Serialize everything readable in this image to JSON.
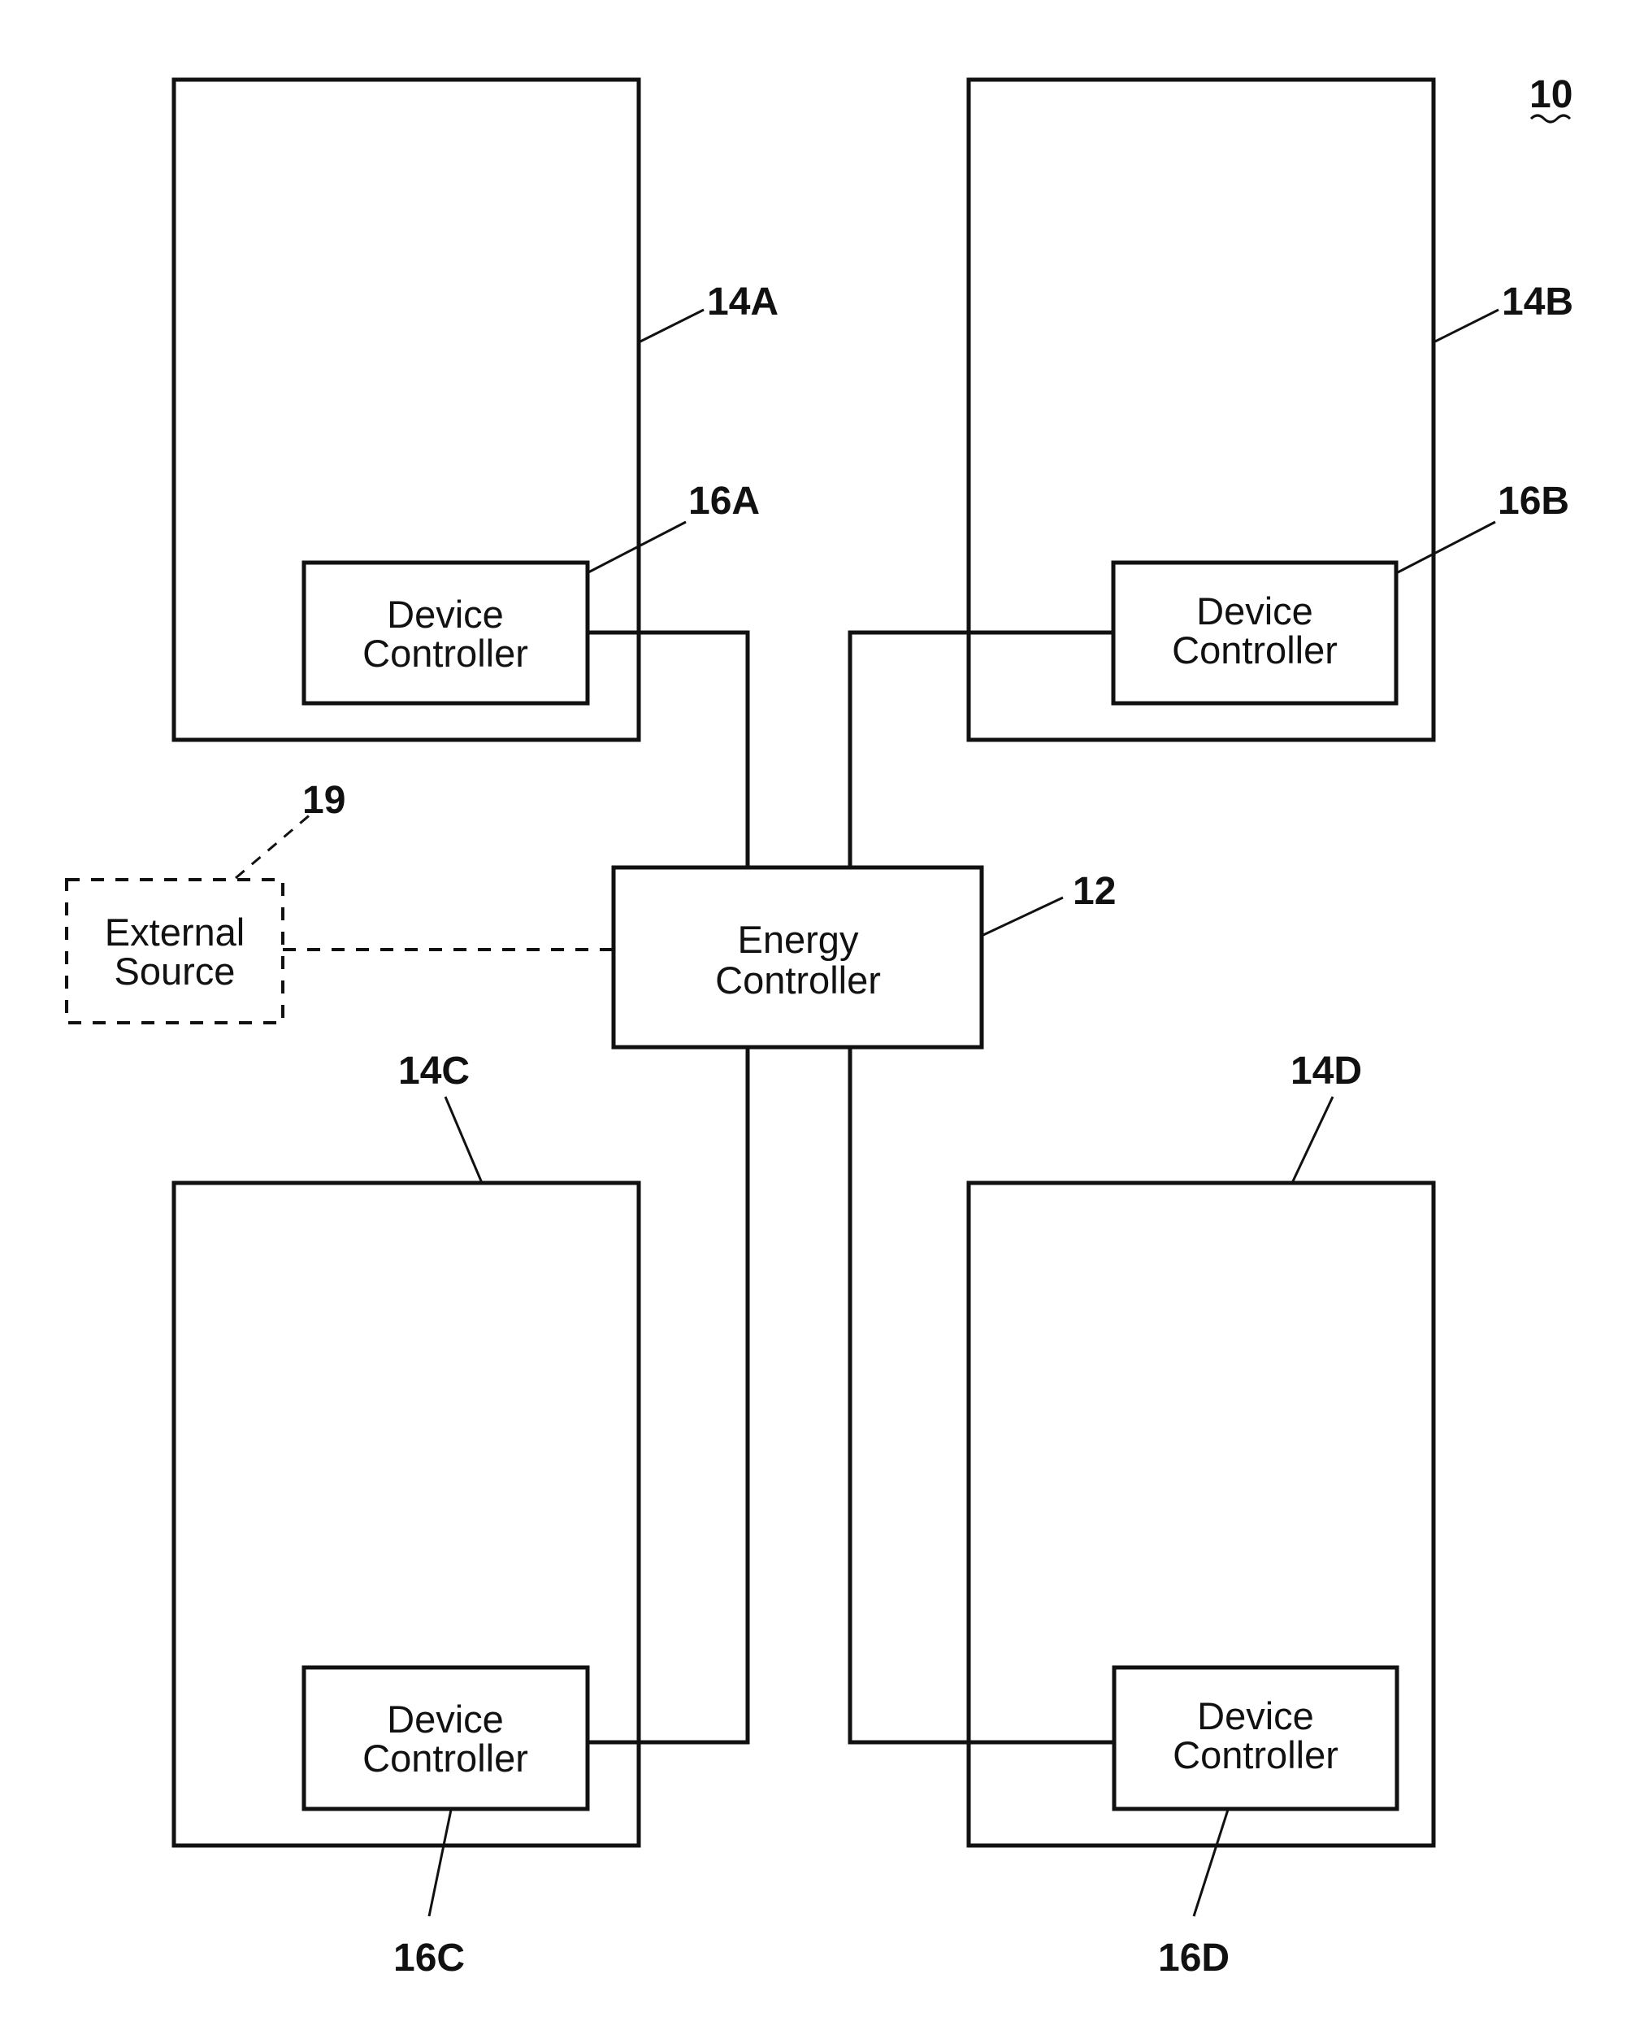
{
  "figure": {
    "reference": "10",
    "energy_controller": {
      "ref": "12",
      "line1": "Energy",
      "line2": "Controller"
    },
    "external_source": {
      "ref": "19",
      "line1": "External",
      "line2": "Source",
      "style": "dashed"
    },
    "devices": [
      {
        "ref": "14A",
        "controller_ref": "16A",
        "controller_line1": "Device",
        "controller_line2": "Controller"
      },
      {
        "ref": "14B",
        "controller_ref": "16B",
        "controller_line1": "Device",
        "controller_line2": "Controller"
      },
      {
        "ref": "14C",
        "controller_ref": "16C",
        "controller_line1": "Device",
        "controller_line2": "Controller"
      },
      {
        "ref": "14D",
        "controller_ref": "16D",
        "controller_line1": "Device",
        "controller_line2": "Controller"
      }
    ],
    "connections": [
      {
        "from": "12",
        "to": "16A",
        "style": "solid"
      },
      {
        "from": "12",
        "to": "16B",
        "style": "solid"
      },
      {
        "from": "12",
        "to": "16C",
        "style": "solid"
      },
      {
        "from": "12",
        "to": "16D",
        "style": "solid"
      },
      {
        "from": "19",
        "to": "12",
        "style": "dashed"
      }
    ]
  }
}
